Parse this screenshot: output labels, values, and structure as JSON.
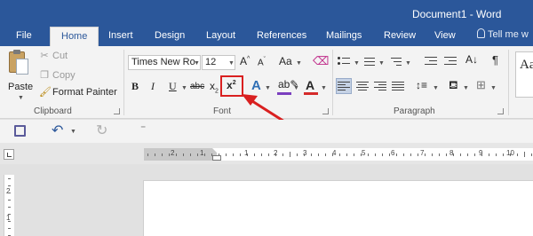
{
  "window": {
    "title": "Document1 - Word"
  },
  "tabs": [
    {
      "label": "File",
      "active": false
    },
    {
      "label": "Home",
      "active": true
    },
    {
      "label": "Insert",
      "active": false
    },
    {
      "label": "Design",
      "active": false
    },
    {
      "label": "Layout",
      "active": false
    },
    {
      "label": "References",
      "active": false
    },
    {
      "label": "Mailings",
      "active": false
    },
    {
      "label": "Review",
      "active": false
    },
    {
      "label": "View",
      "active": false
    }
  ],
  "tell_me": {
    "text": "Tell me w"
  },
  "clipboard": {
    "paste_label": "Paste",
    "cut_label": "Cut",
    "copy_label": "Copy",
    "format_painter_label": "Format Painter",
    "group_label": "Clipboard"
  },
  "font": {
    "font_name": "Times New Ro",
    "font_size": "12",
    "grow_label": "A",
    "shrink_label": "A",
    "change_case_label": "Aa",
    "bold_label": "B",
    "italic_label": "I",
    "underline_label": "U",
    "strikethrough_label": "abc",
    "subscript_label": "x",
    "subscript_sub": "2",
    "superscript_label": "x",
    "superscript_sup": "2",
    "text_effects_label": "A",
    "font_color_label": "A",
    "group_label": "Font",
    "font_color_hex": "#d52b2b",
    "highlight_hex": "#7b3fbf"
  },
  "paragraph": {
    "group_label": "Paragraph"
  },
  "styles": {
    "preview": "Aa"
  },
  "annotation": {
    "color": "#d92020",
    "target": "superscript-button"
  },
  "colors": {
    "title_bar": "#2b579a",
    "ribbon": "#f3f3f3"
  },
  "ruler": {
    "h_labels": [
      "2",
      "1",
      "1",
      "2",
      "3",
      "4",
      "5",
      "6",
      "7",
      "8",
      "9",
      "10"
    ],
    "v_labels": [
      "2",
      "1"
    ]
  }
}
